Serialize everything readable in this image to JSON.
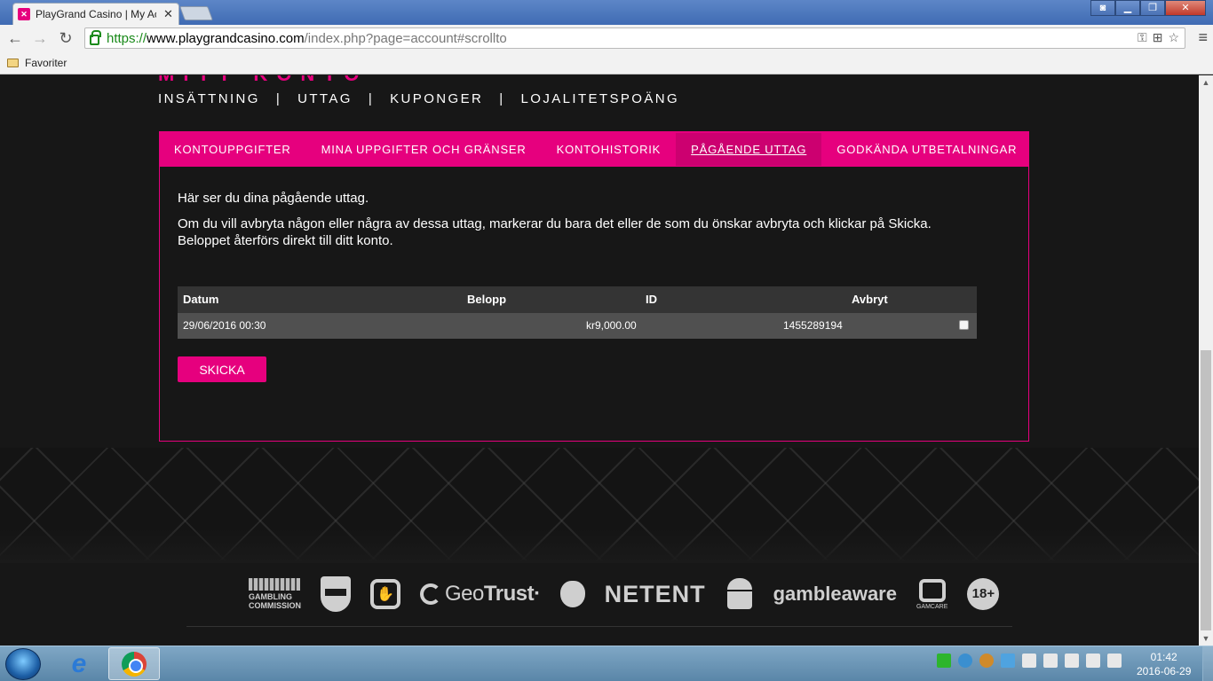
{
  "browser": {
    "tab_title": "PlayGrand Casino | My Ac",
    "tab_close": "✕",
    "url_scheme": "https://",
    "url_host": "www.playgrandcasino.com",
    "url_path": "/index.php?page=account#scrollto",
    "bookmark_folder": "Favoriter"
  },
  "page": {
    "heading_partial": "MITT KONTO",
    "account_nav": [
      "INSÄTTNING",
      "UTTAG",
      "KUPONGER",
      "LOJALITETSPOÄNG"
    ],
    "nav_separator": "|",
    "tabs": [
      "KONTOUPPGIFTER",
      "MINA UPPGIFTER OCH GRÄNSER",
      "KONTOHISTORIK",
      "PÅGÅENDE UTTAG",
      "GODKÄNDA UTBETALNINGAR"
    ],
    "active_tab": "PÅGÅENDE UTTAG",
    "intro_line1": "Här ser du dina pågående uttag.",
    "intro_line2": "Om du vill avbryta någon eller några av dessa uttag, markerar du bara det eller de som du önskar avbryta och klickar på Skicka.",
    "intro_line3": "Beloppet återförs direkt till ditt konto.",
    "table": {
      "headers": [
        "Datum",
        "Belopp",
        "ID",
        "Avbryt"
      ],
      "rows": [
        {
          "datum": "29/06/2016 00:30",
          "belopp": "kr9,000.00",
          "id": "1455289194",
          "avbryt": false
        }
      ]
    },
    "submit_label": "SKICKA"
  },
  "footer": {
    "logos": [
      "gambling-commission",
      "curacao-egaming",
      "stop-hand",
      "geotrust",
      "apple",
      "netent",
      "android",
      "gambleaware",
      "gamcare",
      "18-plus"
    ],
    "gc_line1": "GAMBLING",
    "gc_line2": "COMMISSION",
    "geo_a": "Geo",
    "geo_b": "Trust",
    "geo_dot": "·",
    "netent": "NETENT",
    "gambleaware": "gambleaware",
    "gamcare": "GAMCARE",
    "age": "18+"
  },
  "taskbar": {
    "time": "01:42",
    "date": "2016-06-29"
  },
  "colors": {
    "brand": "#e6007e",
    "background": "#171717"
  }
}
